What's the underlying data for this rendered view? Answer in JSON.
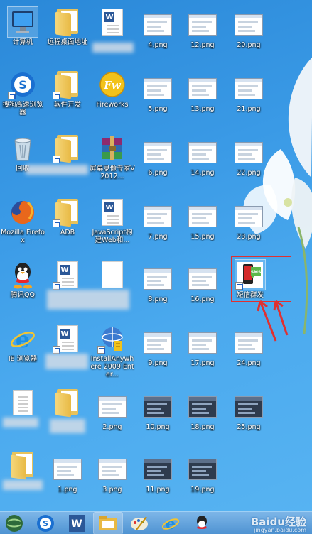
{
  "desktop": {
    "col1": [
      {
        "label": "计算机",
        "icon": "computer-icon"
      },
      {
        "label": "搜狗高速浏览器",
        "icon": "sogou-browser-icon"
      },
      {
        "label": "回收",
        "icon": "recycle-bin-icon"
      },
      {
        "label": "Mozilla Firefox",
        "icon": "firefox-icon"
      },
      {
        "label": "腾讯QQ",
        "icon": "qq-icon"
      },
      {
        "label": "IE 浏览器",
        "icon": "ie-icon"
      },
      {
        "label": "",
        "icon": "document-icon"
      },
      {
        "label": "",
        "icon": "folder-icon"
      }
    ],
    "col2": [
      {
        "label": "远程桌面地址",
        "icon": "folder-icon"
      },
      {
        "label": "软件开发",
        "icon": "folder-icon"
      },
      {
        "label": "",
        "icon": "folder-icon"
      },
      {
        "label": "ADB",
        "icon": "folder-icon"
      },
      {
        "label": "",
        "icon": "word-doc-icon"
      },
      {
        "label": "",
        "icon": "word-doc-icon"
      },
      {
        "label": "",
        "icon": "folder-icon"
      },
      {
        "label": "1.png",
        "icon": "image-thumb-icon"
      }
    ],
    "col3": [
      {
        "label": "",
        "icon": "word-doc-icon"
      },
      {
        "label": "Fireworks",
        "icon": "fireworks-icon"
      },
      {
        "label": "屏幕录像专家V2012...",
        "icon": "winrar-icon"
      },
      {
        "label": "JavaScript构建Web和...",
        "icon": "word-doc-icon"
      },
      {
        "label": "",
        "icon": "blank-file-icon"
      },
      {
        "label": "InstallAnywhere 2009 Enter...",
        "icon": "installer-icon"
      },
      {
        "label": "2.png",
        "icon": "image-thumb-icon"
      },
      {
        "label": "3.png",
        "icon": "image-thumb-icon"
      }
    ],
    "col4": [
      {
        "label": "4.png"
      },
      {
        "label": "5.png"
      },
      {
        "label": "6.png"
      },
      {
        "label": "7.png"
      },
      {
        "label": "8.png"
      },
      {
        "label": "9.png"
      },
      {
        "label": "10.png"
      },
      {
        "label": "11.png"
      }
    ],
    "col5": [
      {
        "label": "12.png"
      },
      {
        "label": "13.png"
      },
      {
        "label": "14.png"
      },
      {
        "label": "15.png"
      },
      {
        "label": "16.png"
      },
      {
        "label": "17.png"
      },
      {
        "label": "18.png"
      },
      {
        "label": "19.png"
      }
    ],
    "col6": [
      {
        "label": "20.png"
      },
      {
        "label": "21.png"
      },
      {
        "label": "22.png"
      },
      {
        "label": "23.png"
      },
      {
        "label": "短信群发",
        "icon": "sms-bulk-app-icon",
        "selected": true
      },
      {
        "label": "24.png"
      },
      {
        "label": "25.png"
      }
    ]
  },
  "taskbar": {
    "items": [
      {
        "icon": "start-globe-icon"
      },
      {
        "icon": "sogou-browser-icon"
      },
      {
        "icon": "word-icon"
      },
      {
        "icon": "file-explorer-icon"
      },
      {
        "icon": "paint-icon"
      },
      {
        "icon": "ie-icon"
      },
      {
        "icon": "qq-icon"
      }
    ],
    "watermark": "Baidu经验",
    "watermark_sub": "jingyan.baidu.com"
  },
  "colors": {
    "desktop_bg": "#3a9ae6",
    "highlight": "#e03030"
  }
}
